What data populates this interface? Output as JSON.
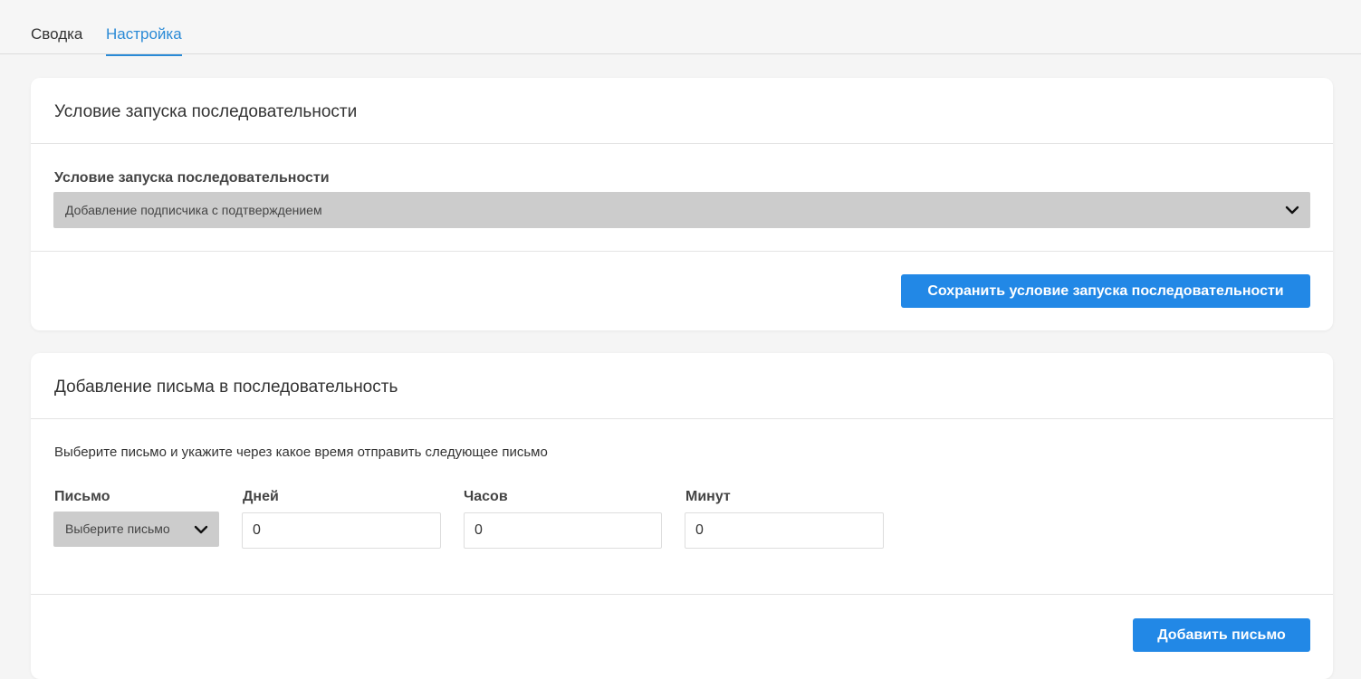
{
  "tabs": [
    {
      "label": "Сводка",
      "active": false
    },
    {
      "label": "Настройка",
      "active": true
    }
  ],
  "colors": {
    "accent": "#2a8ad6",
    "button": "#2288e6",
    "select_bg": "#cccccc"
  },
  "trigger_card": {
    "title": "Условие запуска последовательности",
    "field_label": "Условие запуска последовательности",
    "select_value": "Добавление подписчика с подтверждением",
    "save_button": "Сохранить условие запуска последовательности"
  },
  "email_card": {
    "title": "Добавление письма в последовательность",
    "description": "Выберите письмо и укажите через какое время отправить следующее письмо",
    "letter_label": "Письмо",
    "letter_select": "Выберите письмо",
    "days_label": "Дней",
    "days_value": "0",
    "hours_label": "Часов",
    "hours_value": "0",
    "minutes_label": "Минут",
    "minutes_value": "0",
    "add_button": "Добавить письмо"
  },
  "icons": {
    "select_arrow": "chevron-down-icon"
  }
}
